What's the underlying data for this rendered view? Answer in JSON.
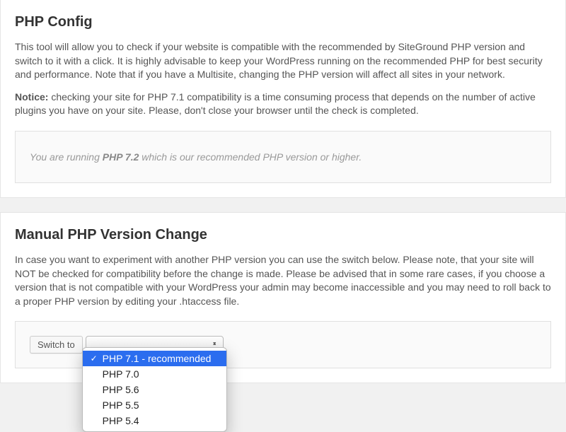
{
  "section1": {
    "title": "PHP Config",
    "desc": "This tool will allow you to check if your website is compatible with the recommended by SiteGround PHP version and switch to it with a click. It is highly advisable to keep your WordPress running on the recommended PHP for best security and performance. Note that if you have a Multisite, changing the PHP version will affect all sites in your network.",
    "notice_label": "Notice:",
    "notice_text": " checking your site for PHP 7.1 compatibility is a time consuming process that depends on the number of active plugins you have on your site. Please, don't close your browser until the check is completed.",
    "callout_pre": "You are running ",
    "callout_strong": "PHP 7.2",
    "callout_post": " which is our recommended PHP version or higher."
  },
  "section2": {
    "title": "Manual PHP Version Change",
    "desc": "In case you want to experiment with another PHP version you can use the switch below. Please note, that your site will NOT be checked for compatibility before the change is made. Please be advised that in some rare cases, if you choose a version that is not compatible with your WordPress your admin may become inaccessible and you may need to roll back to a proper PHP version by editing your .htaccess file.",
    "button_label": "Switch to",
    "options": [
      "PHP 7.1 - recommended",
      "PHP 7.0",
      "PHP 5.6",
      "PHP 5.5",
      "PHP 5.4"
    ],
    "selected_index": 0
  }
}
